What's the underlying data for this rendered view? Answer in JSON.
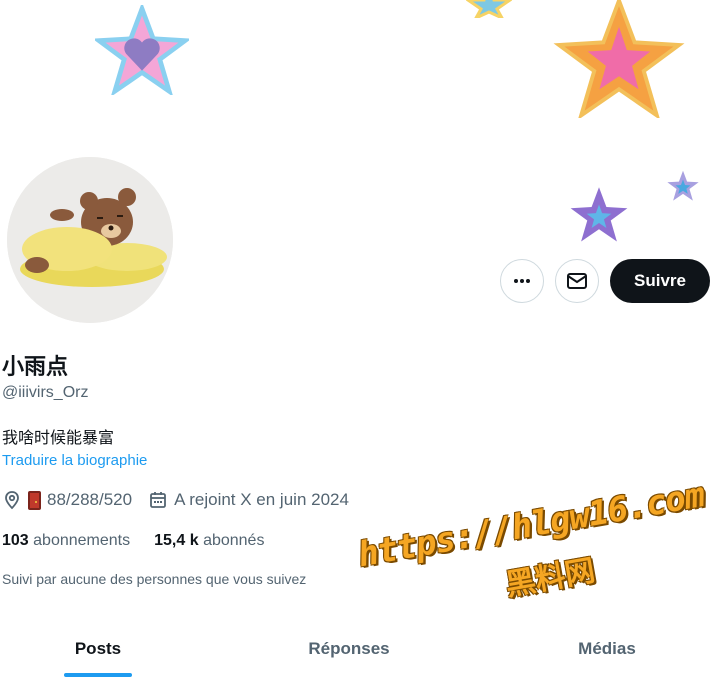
{
  "profile": {
    "name": "小雨点",
    "handle": "@iiivirs_Orz",
    "bio": "我啥时候能暴富",
    "translate_label": "Traduire la biographie",
    "location": "88/288/520",
    "joined": "A rejoint X en juin 2024",
    "following_count": "103",
    "following_label": "abonnements",
    "followers_count": "15,4 k",
    "followers_label": "abonnés",
    "followed_by": "Suivi par aucune des personnes que vous suivez"
  },
  "actions": {
    "more_icon": "more-icon",
    "message_icon": "mail-icon",
    "follow_label": "Suivre"
  },
  "tabs": [
    {
      "label": "Posts",
      "active": true
    },
    {
      "label": "Réponses",
      "active": false
    },
    {
      "label": "Médias",
      "active": false
    }
  ],
  "watermark": {
    "line1": "https://hlgw16.com",
    "line2": "黑料网"
  },
  "colors": {
    "accent": "#1d9bf0",
    "primary_text": "#0f1419",
    "secondary_text": "#536471",
    "follow_button_bg": "#0f1419"
  }
}
